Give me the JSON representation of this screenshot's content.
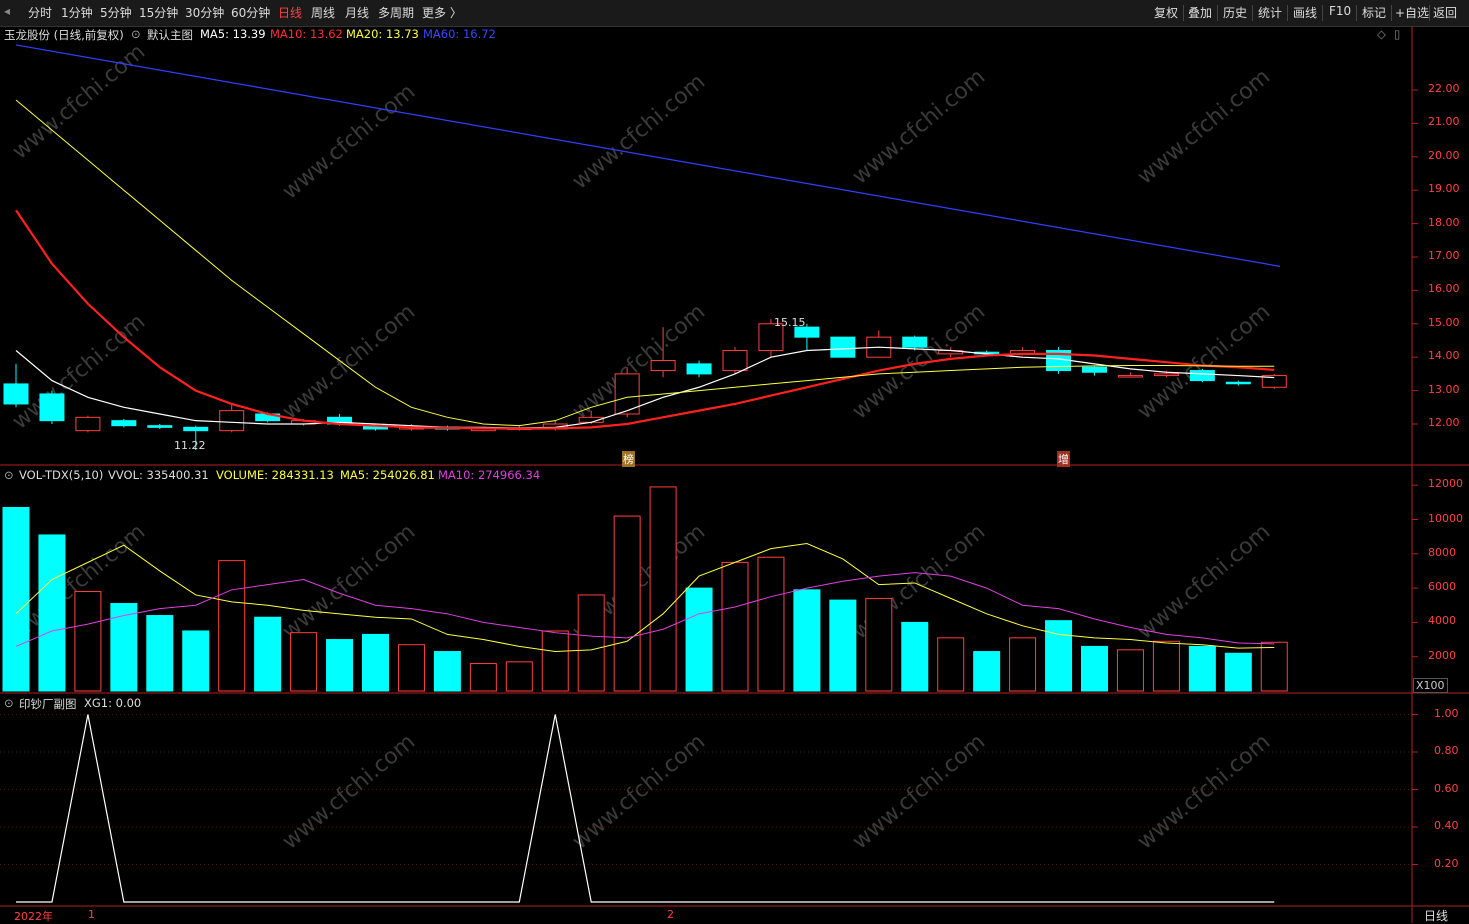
{
  "toolbar": {
    "left_items": [
      "分时",
      "1分钟",
      "5分钟",
      "15分钟",
      "30分钟",
      "60分钟",
      "日线",
      "周线",
      "月线",
      "多周期",
      "更多 〉"
    ],
    "active_index": 6,
    "right_items": [
      "复权",
      "叠加",
      "历史",
      "统计",
      "画线",
      "F10",
      "标记",
      "+自选",
      "返回"
    ]
  },
  "main_panel": {
    "stock_title": "玉龙股份 (日线,前复权)",
    "template": "默认主图",
    "ma5": "MA5: 13.39",
    "ma10": "MA10: 13.62",
    "ma20": "MA20: 13.73",
    "ma60": "MA60: 16.72",
    "y_ticks": [
      "22.00",
      "21.00",
      "20.00",
      "19.00",
      "18.00",
      "17.00",
      "16.00",
      "15.00",
      "14.00",
      "13.00",
      "12.00"
    ],
    "high_label": "15.15",
    "low_label": "11.22",
    "marker1": "榜",
    "marker2": "增",
    "colors": {
      "ma5": "#ffffff",
      "ma10": "#ff2020",
      "ma20": "#ffff40",
      "ma60": "#3040ff",
      "up": "#ff4040",
      "down": "#00ffff"
    }
  },
  "volume_panel": {
    "title": "VOL-TDX(5,10)",
    "vvol": "VVOL: 335400.31",
    "volume": "VOLUME: 284331.13",
    "ma5": "MA5: 254026.81",
    "ma10": "MA10: 274966.34",
    "y_ticks": [
      "12000",
      "10000",
      "8000",
      "6000",
      "4000",
      "2000"
    ],
    "unit": "X100"
  },
  "sub_panel": {
    "title": "印钞厂副图",
    "xg1": "XG1: 0.00",
    "y_ticks": [
      "1.00",
      "0.80",
      "0.60",
      "0.40",
      "0.20"
    ]
  },
  "x_axis": {
    "year": "2022年",
    "month1": "1",
    "month2": "2",
    "period": "日线"
  },
  "watermark": "www.cfchi.com"
}
